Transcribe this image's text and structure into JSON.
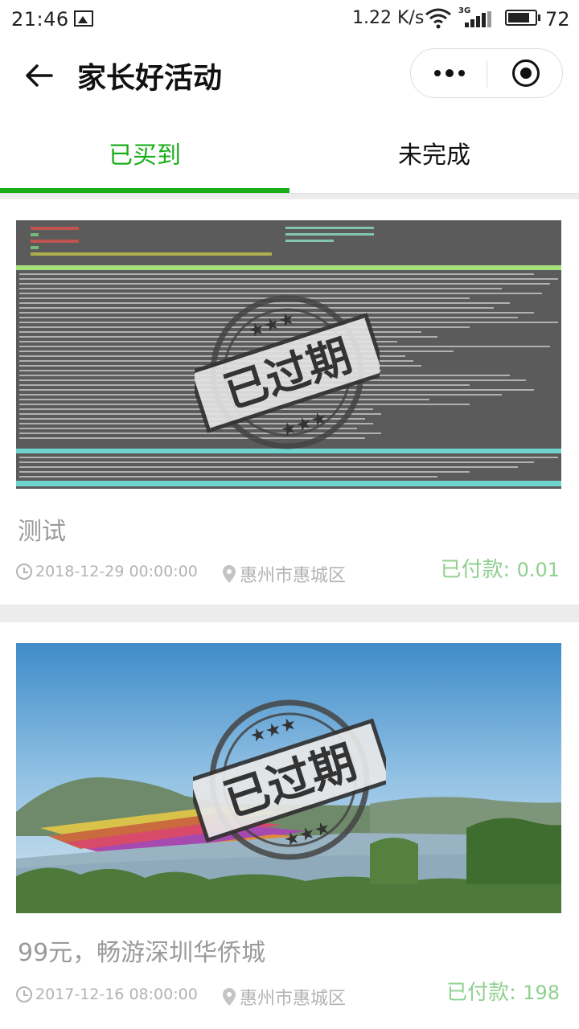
{
  "status_bar": {
    "time": "21:46",
    "speed": "1.22 K/s",
    "network_type": "3G",
    "battery": "72"
  },
  "nav": {
    "title": "家长好活动"
  },
  "tabs": [
    {
      "label": "已买到",
      "active": true
    },
    {
      "label": "未完成",
      "active": false
    }
  ],
  "colors": {
    "accent": "#1aad19",
    "paid": "#8fd08f",
    "muted": "#b3b3b3"
  },
  "orders": [
    {
      "title": "测试",
      "datetime": "2018-12-29 00:00:00",
      "location": "惠州市惠城区",
      "paid_label": "已付款:",
      "paid_amount": "0.01",
      "stamp_text": "已过期",
      "thumbnail": "terminal-screenshot-image"
    },
    {
      "title": "99元，畅游深圳华侨城",
      "datetime": "2017-12-16 08:00:00",
      "location": "惠州市惠城区",
      "paid_label": "已付款:",
      "paid_amount": "198",
      "stamp_text": "已过期",
      "thumbnail": "landscape-lake-image"
    }
  ]
}
